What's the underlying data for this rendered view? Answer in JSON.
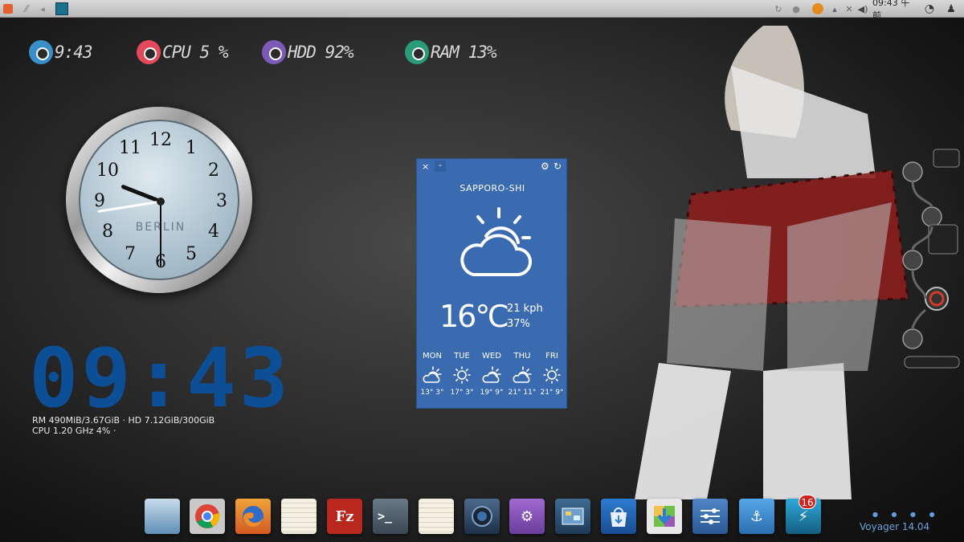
{
  "top_panel": {
    "clock": "09:43 午前",
    "icons": {
      "apps": "ubuntu-logo-icon",
      "tasks": "task-switcher-icon",
      "back": "back-icon",
      "launcher": "app-launcher-icon",
      "sync": "sync-icon",
      "dot": "status-dot-icon",
      "updates": "software-update-icon",
      "network": "network-icon",
      "bluetooth": "bluetooth-icon",
      "volume": "volume-icon",
      "chat": "messaging-icon",
      "user": "user-icon"
    },
    "accent": "#e2602e"
  },
  "conky_stats": {
    "clock": "9:43",
    "cpu": "CPU 5 %",
    "hdd": "HDD 92%",
    "ram": "RAM 13%",
    "colors": {
      "clock": "#3a8ec9",
      "cpu": "#e2495b",
      "hdd": "#7c5bb8",
      "ram": "#2a9a78"
    }
  },
  "analog_clock": {
    "city": "BERLIN",
    "numerals": [
      "12",
      "1",
      "2",
      "3",
      "4",
      "5",
      "6",
      "7",
      "8",
      "9",
      "10",
      "11"
    ],
    "hours": 9,
    "minutes": 43,
    "seconds": 30
  },
  "digital_clock": {
    "time": "09:43",
    "color": "#0c4f96",
    "line1": "RM 490MiB/3.67GiB · HD 7.12GiB/300GiB",
    "line2": "CPU 1.20 GHz 4% ·"
  },
  "weather": {
    "close_label": "×",
    "min_label": "-",
    "city": "SAPPORO-SHI",
    "temperature": "16℃",
    "wind": "21 kph",
    "humidity": "37%",
    "current_icon": "partly-cloudy-icon",
    "background": "#3a6ab0",
    "forecast": [
      {
        "day": "MON",
        "temps": "13° 3°",
        "icon": "partly-cloudy-icon"
      },
      {
        "day": "TUE",
        "temps": "17° 3°",
        "icon": "sunny-icon"
      },
      {
        "day": "WED",
        "temps": "19° 9°",
        "icon": "partly-cloudy-icon"
      },
      {
        "day": "THU",
        "temps": "21° 11°",
        "icon": "partly-cloudy-icon"
      },
      {
        "day": "FRI",
        "temps": "21° 9°",
        "icon": "sunny-icon"
      }
    ]
  },
  "dock": {
    "items": [
      {
        "name": "file-manager-icon",
        "glyph": ""
      },
      {
        "name": "chrome-icon",
        "glyph": ""
      },
      {
        "name": "firefox-icon",
        "glyph": ""
      },
      {
        "name": "notes-icon",
        "glyph": ""
      },
      {
        "name": "filezilla-icon",
        "glyph": "Fz"
      },
      {
        "name": "terminal-icon",
        "glyph": ">_"
      },
      {
        "name": "notes-icon",
        "glyph": ""
      },
      {
        "name": "webcam-icon",
        "glyph": ""
      },
      {
        "name": "settings-gear-icon",
        "glyph": ""
      },
      {
        "name": "desktop-switcher-icon",
        "glyph": ""
      },
      {
        "name": "software-store-icon",
        "glyph": ""
      },
      {
        "name": "installer-icon",
        "glyph": ""
      },
      {
        "name": "tweak-tool-icon",
        "glyph": ""
      },
      {
        "name": "anchor-icon",
        "glyph": "⚓"
      },
      {
        "name": "flash-icon",
        "glyph": "⚡"
      }
    ],
    "badge": "16"
  },
  "workspace_dots": "● ● ● ●",
  "os_label": "Voyager 14.04"
}
